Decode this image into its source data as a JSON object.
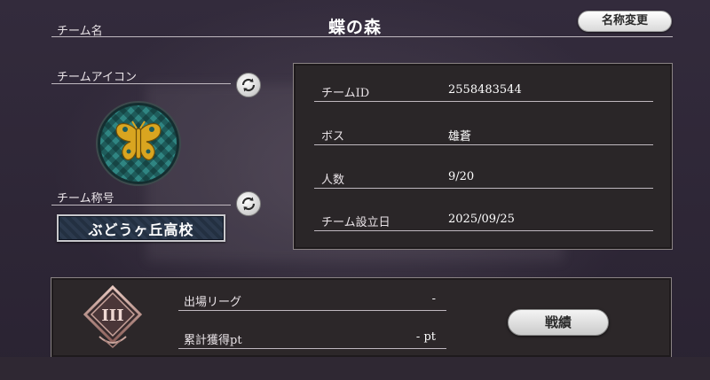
{
  "header": {
    "team_name_label": "チーム名",
    "team_name": "蝶の森",
    "rename_button": "名称変更"
  },
  "left": {
    "icon_label": "チームアイコン",
    "title_label": "チーム称号",
    "title_value": "ぶどうヶ丘高校"
  },
  "info": {
    "rows": [
      {
        "key": "チームID",
        "value": "2558483544"
      },
      {
        "key": "ボス",
        "value": "雄蒼"
      },
      {
        "key": "人数",
        "value": "9/20"
      },
      {
        "key": "チーム設立日",
        "value": "2025/09/25"
      }
    ]
  },
  "league": {
    "rank_numeral": "III",
    "rows": [
      {
        "key": "出場リーグ",
        "value": "-"
      },
      {
        "key": "累計獲得pt",
        "value": "- pt"
      }
    ],
    "record_button": "戦績"
  },
  "colors": {
    "background": "#2e2736",
    "emblem_teal": "#2b7674",
    "emblem_gold": "#d9a520",
    "title_plate": "#27344a"
  }
}
